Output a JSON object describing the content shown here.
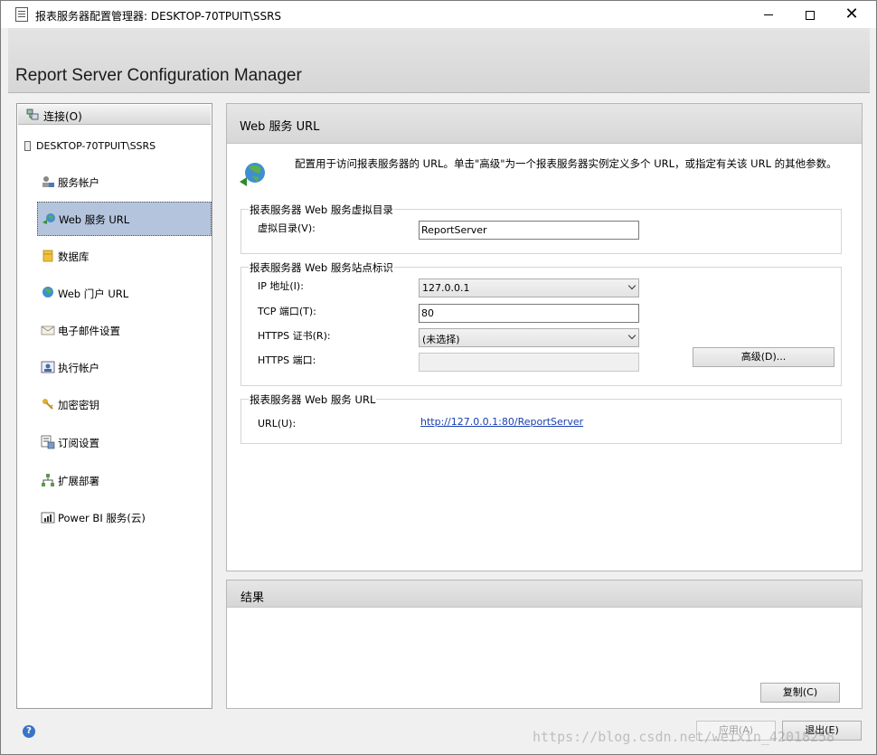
{
  "window": {
    "title": "报表服务器配置管理器: DESKTOP-70TPUIT\\SSRS",
    "controls": {
      "minimize": "—",
      "maximize": "□",
      "close": "✕"
    }
  },
  "banner": {
    "product": "Report Server Configuration Manager"
  },
  "nav": {
    "connect_label": "连接(O)",
    "server": "DESKTOP-70TPUIT\\SSRS",
    "items": [
      {
        "label": "服务帐户",
        "icon": "service-account-icon"
      },
      {
        "label": "Web 服务 URL",
        "icon": "web-service-url-icon",
        "active": true
      },
      {
        "label": "数据库",
        "icon": "database-icon"
      },
      {
        "label": "Web 门户 URL",
        "icon": "web-portal-icon"
      },
      {
        "label": "电子邮件设置",
        "icon": "email-icon"
      },
      {
        "label": "执行帐户",
        "icon": "execution-account-icon"
      },
      {
        "label": "加密密钥",
        "icon": "encryption-key-icon"
      },
      {
        "label": "订阅设置",
        "icon": "subscription-icon"
      },
      {
        "label": "扩展部署",
        "icon": "scale-out-icon"
      },
      {
        "label": "Power BI 服务(云)",
        "icon": "power-bi-icon"
      }
    ]
  },
  "panel": {
    "title": "Web 服务 URL",
    "description": "配置用于访问报表服务器的 URL。单击\"高级\"为一个报表服务器实例定义多个 URL，或指定有关该 URL 的其他参数。",
    "virtual_dir_group": {
      "title": "报表服务器 Web 服务虚拟目录",
      "label": "虚拟目录(V):",
      "value": "ReportServer"
    },
    "site_group": {
      "title": "报表服务器 Web 服务站点标识",
      "ip_label": "IP 地址(I):",
      "ip_value": "127.0.0.1",
      "tcp_label": "TCP 端口(T):",
      "tcp_value": "80",
      "https_cert_label": "HTTPS 证书(R):",
      "https_cert_value": "(未选择)",
      "https_port_label": "HTTPS 端口:",
      "https_port_value": "",
      "advanced_button": "高级(D)..."
    },
    "url_group": {
      "title": "报表服务器 Web 服务 URL",
      "label": "URL(U):",
      "url": "http://127.0.0.1:80/ReportServer"
    }
  },
  "results": {
    "title": "结果",
    "copy_button": "复制(C)"
  },
  "footer": {
    "apply_button": "应用(A)",
    "exit_button": "退出(E)",
    "watermark": "https://blog.csdn.net/weixin_42018258"
  }
}
